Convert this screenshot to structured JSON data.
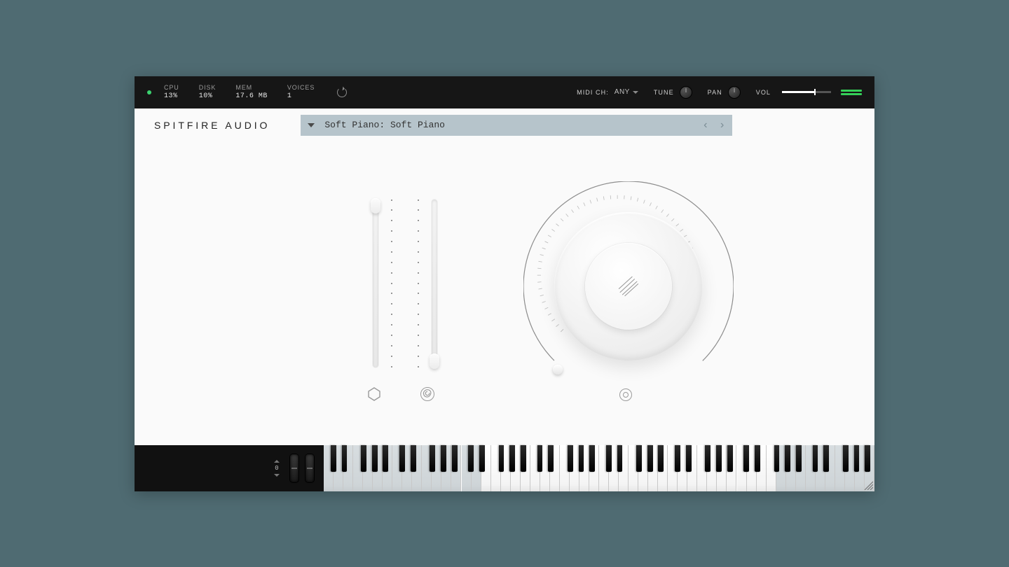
{
  "brand": "SPITFIRE AUDIO",
  "topbar": {
    "cpu": {
      "label": "CPU",
      "value": "13%"
    },
    "disk": {
      "label": "DISK",
      "value": "10%"
    },
    "mem": {
      "label": "MEM",
      "value": "17.6 MB"
    },
    "voices": {
      "label": "VOICES",
      "value": "1"
    },
    "midi": {
      "label": "MIDI CH:",
      "value": "ANY"
    },
    "tune": {
      "label": "TUNE"
    },
    "pan": {
      "label": "PAN"
    },
    "vol": {
      "label": "VOL",
      "level_pct": 65
    }
  },
  "preset": {
    "name": "Soft Piano: Soft Piano"
  },
  "controls": {
    "slider1_value_pct": 100,
    "slider2_value_pct": 0,
    "dial_value_pct": 0,
    "icon1": "dynamics-icon",
    "icon2": "expression-icon",
    "dial_icon": "reverb-icon"
  },
  "keyboard": {
    "octave_offset": "0",
    "octaves": 8,
    "active_from_white_key": 16,
    "active_to_white_key": 45
  },
  "colors": {
    "bg": "#4f6b72",
    "panel": "#fafafa",
    "preset_bg": "#b6c4cb",
    "accent": "#34d058"
  }
}
